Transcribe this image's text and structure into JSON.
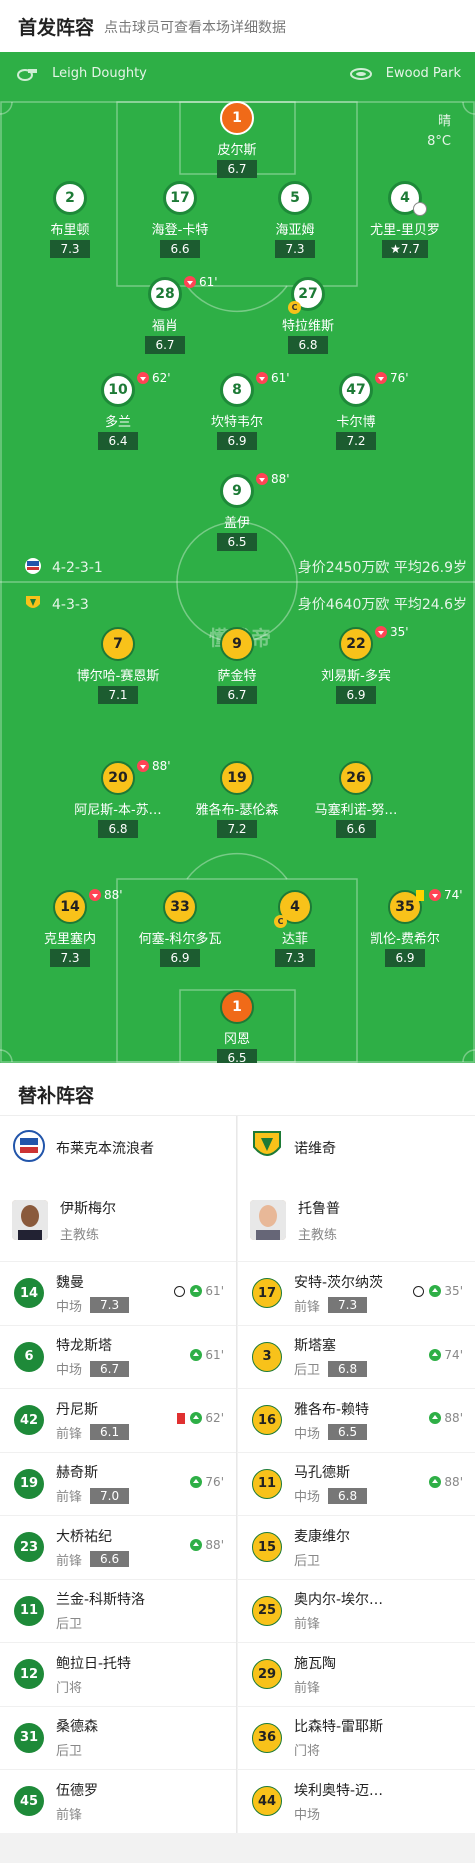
{
  "header": {
    "title": "首发阵容",
    "subtitle": "点击球员可查看本场详细数据"
  },
  "match": {
    "referee": "Leigh Doughty",
    "venue": "Ewood Park",
    "weather": "晴",
    "temperature": "8°C",
    "watermark": "懂球帝"
  },
  "home_team": {
    "formation": "4-2-3-1",
    "value": "身价2450万欧 平均26.9岁",
    "players": [
      {
        "num": "1",
        "name": "皮尔斯",
        "rating": "6.7"
      },
      {
        "num": "2",
        "name": "布里顿",
        "rating": "7.3"
      },
      {
        "num": "17",
        "name": "海登-卡特",
        "rating": "6.6"
      },
      {
        "num": "5",
        "name": "海亚姆",
        "rating": "7.3"
      },
      {
        "num": "4",
        "name": "尤里-里贝罗",
        "rating": "7.7"
      },
      {
        "num": "28",
        "name": "福肖",
        "rating": "6.7",
        "sub": "61'"
      },
      {
        "num": "27",
        "name": "特拉维斯",
        "rating": "6.8",
        "captain": "C"
      },
      {
        "num": "10",
        "name": "多兰",
        "rating": "6.4",
        "sub": "62'"
      },
      {
        "num": "8",
        "name": "坎特韦尔",
        "rating": "6.9",
        "sub": "61'"
      },
      {
        "num": "47",
        "name": "卡尔博",
        "rating": "7.2",
        "sub": "76'"
      },
      {
        "num": "9",
        "name": "盖伊",
        "rating": "6.5",
        "sub": "88'"
      }
    ]
  },
  "away_team": {
    "formation": "4-3-3",
    "value": "身价4640万欧 平均24.6岁",
    "players": [
      {
        "num": "7",
        "name": "博尔哈-赛恩斯",
        "rating": "7.1"
      },
      {
        "num": "9",
        "name": "萨金特",
        "rating": "6.7"
      },
      {
        "num": "22",
        "name": "刘易斯-多宾",
        "rating": "6.9",
        "sub": "35'"
      },
      {
        "num": "20",
        "name": "阿尼斯-本-苏…",
        "rating": "6.8",
        "sub": "88'"
      },
      {
        "num": "19",
        "name": "雅各布-瑟伦森",
        "rating": "7.2"
      },
      {
        "num": "26",
        "name": "马塞利诺-努…",
        "rating": "6.6"
      },
      {
        "num": "14",
        "name": "克里塞内",
        "rating": "7.3",
        "sub": "88'"
      },
      {
        "num": "33",
        "name": "何塞-科尔多瓦",
        "rating": "6.9"
      },
      {
        "num": "4",
        "name": "达菲",
        "rating": "7.3",
        "captain": "C"
      },
      {
        "num": "35",
        "name": "凯伦-费希尔",
        "rating": "6.9",
        "sub": "74'"
      },
      {
        "num": "1",
        "name": "冈恩",
        "rating": "6.5"
      }
    ]
  },
  "subs": {
    "title": "替补阵容",
    "home": {
      "team": "布莱克本流浪者",
      "coach": {
        "name": "伊斯梅尔",
        "role": "主教练"
      },
      "players": [
        {
          "num": "14",
          "name": "魏曼",
          "pos": "中场",
          "rating": "7.3",
          "event": "61'"
        },
        {
          "num": "6",
          "name": "特龙斯塔",
          "pos": "中场",
          "rating": "6.7",
          "event": "61'"
        },
        {
          "num": "42",
          "name": "丹尼斯",
          "pos": "前锋",
          "rating": "6.1",
          "event": "62'"
        },
        {
          "num": "19",
          "name": "赫奇斯",
          "pos": "前锋",
          "rating": "7.0",
          "event": "76'"
        },
        {
          "num": "23",
          "name": "大桥祐纪",
          "pos": "前锋",
          "rating": "6.6",
          "event": "88'"
        },
        {
          "num": "11",
          "name": "兰金-科斯特洛",
          "pos": "后卫"
        },
        {
          "num": "12",
          "name": "鲍拉日-托特",
          "pos": "门将"
        },
        {
          "num": "31",
          "name": "桑德森",
          "pos": "后卫"
        },
        {
          "num": "45",
          "name": "伍德罗",
          "pos": "前锋"
        }
      ]
    },
    "away": {
      "team": "诺维奇",
      "coach": {
        "name": "托鲁普",
        "role": "主教练"
      },
      "players": [
        {
          "num": "17",
          "name": "安特-茨尔纳茨",
          "pos": "前锋",
          "rating": "7.3",
          "event": "35'"
        },
        {
          "num": "3",
          "name": "斯塔塞",
          "pos": "后卫",
          "rating": "6.8",
          "event": "74'"
        },
        {
          "num": "16",
          "name": "雅各布-赖特",
          "pos": "中场",
          "rating": "6.5",
          "event": "88'"
        },
        {
          "num": "11",
          "name": "马孔德斯",
          "pos": "中场",
          "rating": "6.8",
          "event": "88'"
        },
        {
          "num": "15",
          "name": "麦康维尔",
          "pos": "后卫"
        },
        {
          "num": "25",
          "name": "奥内尔-埃尔…",
          "pos": "前锋"
        },
        {
          "num": "29",
          "name": "施瓦陶",
          "pos": "前锋"
        },
        {
          "num": "36",
          "name": "比森特-雷耶斯",
          "pos": "门将"
        },
        {
          "num": "44",
          "name": "埃利奥特-迈…",
          "pos": "中场"
        }
      ]
    }
  },
  "colors": {
    "pitch": "#2eaf46",
    "home": "#1e8a39",
    "away": "#f8c21a",
    "goalkeeper": "#f06a18"
  }
}
